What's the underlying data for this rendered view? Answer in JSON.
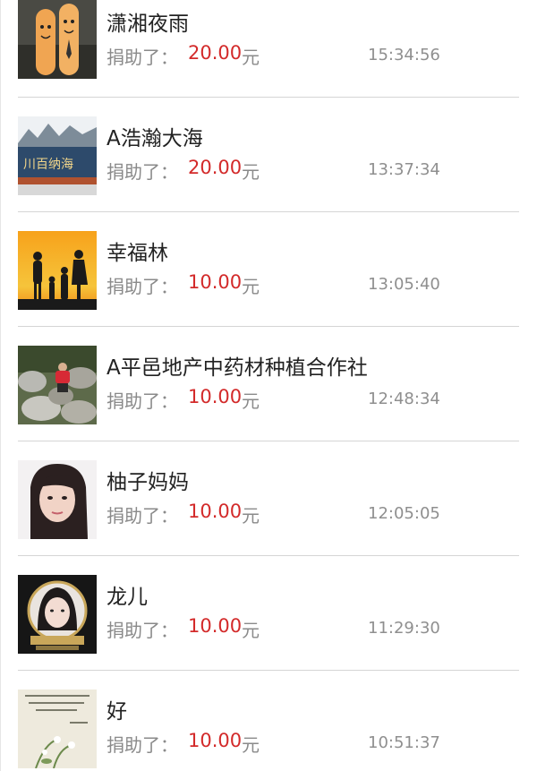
{
  "donations": {
    "label": "捐助了：",
    "unit": "元",
    "items": [
      {
        "name": "潇湘夜雨",
        "amount": "20.00",
        "time": "15:34:56",
        "avatar_icon": "finger-couple-avatar"
      },
      {
        "name": "A浩瀚大海",
        "amount": "20.00",
        "time": "13:37:34",
        "avatar_icon": "sea-sign-avatar"
      },
      {
        "name": "幸福林",
        "amount": "10.00",
        "time": "13:05:40",
        "avatar_icon": "family-sunset-avatar"
      },
      {
        "name": "A平邑地产中药材种植合作社",
        "amount": "10.00",
        "time": "12:48:34",
        "avatar_icon": "rocks-person-avatar"
      },
      {
        "name": "柚子妈妈",
        "amount": "10.00",
        "time": "12:05:05",
        "avatar_icon": "woman-portrait-avatar"
      },
      {
        "name": "龙儿",
        "amount": "10.00",
        "time": "11:29:30",
        "avatar_icon": "framed-portrait-avatar"
      },
      {
        "name": "好 ",
        "amount": "10.00",
        "time": "10:51:37",
        "avatar_icon": "calligraphy-flowers-avatar"
      }
    ]
  },
  "colors": {
    "amount": "#d32a2a",
    "name": "#222222",
    "secondary": "#8a8a8a"
  }
}
